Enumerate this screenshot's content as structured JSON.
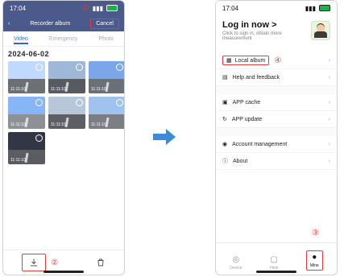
{
  "left_phone": {
    "status_time": "17:04",
    "marker_1": "①",
    "nav": {
      "title": "Recorder album",
      "cancel_label": "Cancel"
    },
    "tabs": [
      "Video",
      "Emergency",
      "Photo"
    ],
    "date": "2024-06-02",
    "thumbnails": [
      {
        "time": "11:11:10"
      },
      {
        "time": "11:11:10"
      },
      {
        "time": "11:11:10"
      },
      {
        "time": "11:11:10"
      },
      {
        "time": "11:11:10"
      },
      {
        "time": "11:11:10"
      },
      {
        "time": "11:11:10"
      }
    ],
    "marker_2": "②"
  },
  "right_phone": {
    "status_time": "17:04",
    "login_title": "Log in now >",
    "login_sub": "Click to sign in, obtain more measurement",
    "menu": [
      {
        "label": "Local album",
        "icon": "album-icon"
      },
      {
        "label": "Help and feedback",
        "icon": "help-icon"
      },
      {
        "label": "APP cache",
        "icon": "cache-icon"
      },
      {
        "label": "APP update",
        "icon": "update-icon"
      },
      {
        "label": "Account management",
        "icon": "account-icon"
      },
      {
        "label": "About",
        "icon": "info-icon"
      }
    ],
    "marker_3": "③",
    "marker_4": "④",
    "bottom_tabs": [
      {
        "label": "Device",
        "icon": "device-icon"
      },
      {
        "label": "Help",
        "icon": "help-icon"
      },
      {
        "label": "Mine",
        "icon": "user-icon"
      }
    ]
  },
  "colors": {
    "primary": "#2d66d9",
    "annotation": "#e23d3d",
    "left_header": "#4b5a8a"
  }
}
